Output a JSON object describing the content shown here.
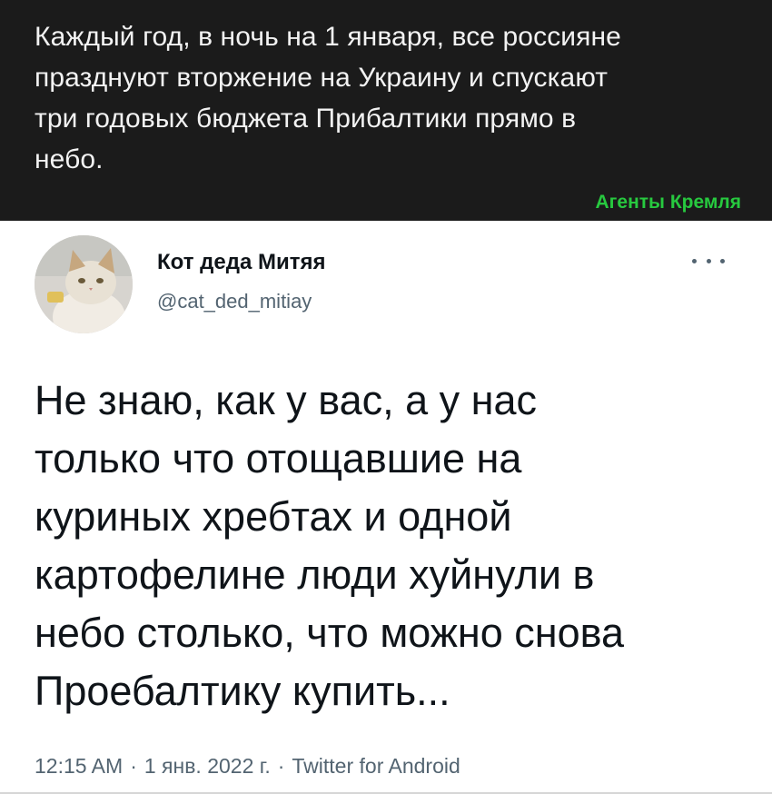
{
  "banner": {
    "text": "Каждый год, в ночь на 1 января, все россияне\nпразднуют вторжение на Украину и спускают\nтри годовых бюджета Прибалтики прямо в\nнебо.",
    "source": "Агенты Кремля"
  },
  "tweet": {
    "display_name": "Кот деда Митяя",
    "handle": "@cat_ded_mitiay",
    "more_icon": "more-horizontal-icon",
    "text": "Не знаю, как у вас, а у нас\nтолько что отощавшие на\nкуриных хребтах и одной\nкартофелине люди хуйнули в\nнебо столько, что можно снова\nПроебалтику купить...",
    "time": "12:15 AM",
    "date": "1 янв. 2022 г.",
    "client": "Twitter for Android",
    "separator": "·"
  },
  "colors": {
    "banner_bg": "#1b1b1b",
    "banner_text": "#f2f2f2",
    "source_green": "#27c93f",
    "muted": "#536471"
  }
}
